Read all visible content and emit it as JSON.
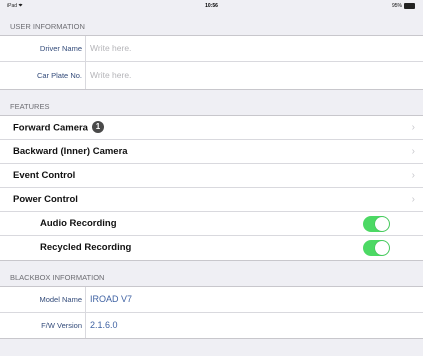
{
  "status_bar": {
    "device": "iPad",
    "time": "10:56",
    "battery": "95%"
  },
  "user_info": {
    "header": "USER INFORMATION",
    "driver_name": {
      "label": "Driver Name",
      "placeholder": "Write here."
    },
    "car_plate": {
      "label": "Car Plate No.",
      "placeholder": "Write here."
    }
  },
  "features": {
    "header": "FEATURES",
    "forward_camera": "Forward Camera",
    "forward_badge": "1",
    "backward_camera": "Backward (Inner) Camera",
    "event_control": "Event Control",
    "power_control": "Power Control",
    "audio_recording": "Audio Recording",
    "recycled_recording": "Recycled Recording",
    "audio_on": true,
    "recycled_on": true,
    "toggle_color": "#4cd964"
  },
  "blackbox": {
    "header": "BLACKBOX INFORMATION",
    "model_label": "Model Name",
    "model_value": "IROAD V7",
    "fw_label": "F/W Version",
    "fw_value": "2.1.6.0"
  },
  "icons": [
    "wifi-icon",
    "battery-icon",
    "chevron-right-icon"
  ]
}
